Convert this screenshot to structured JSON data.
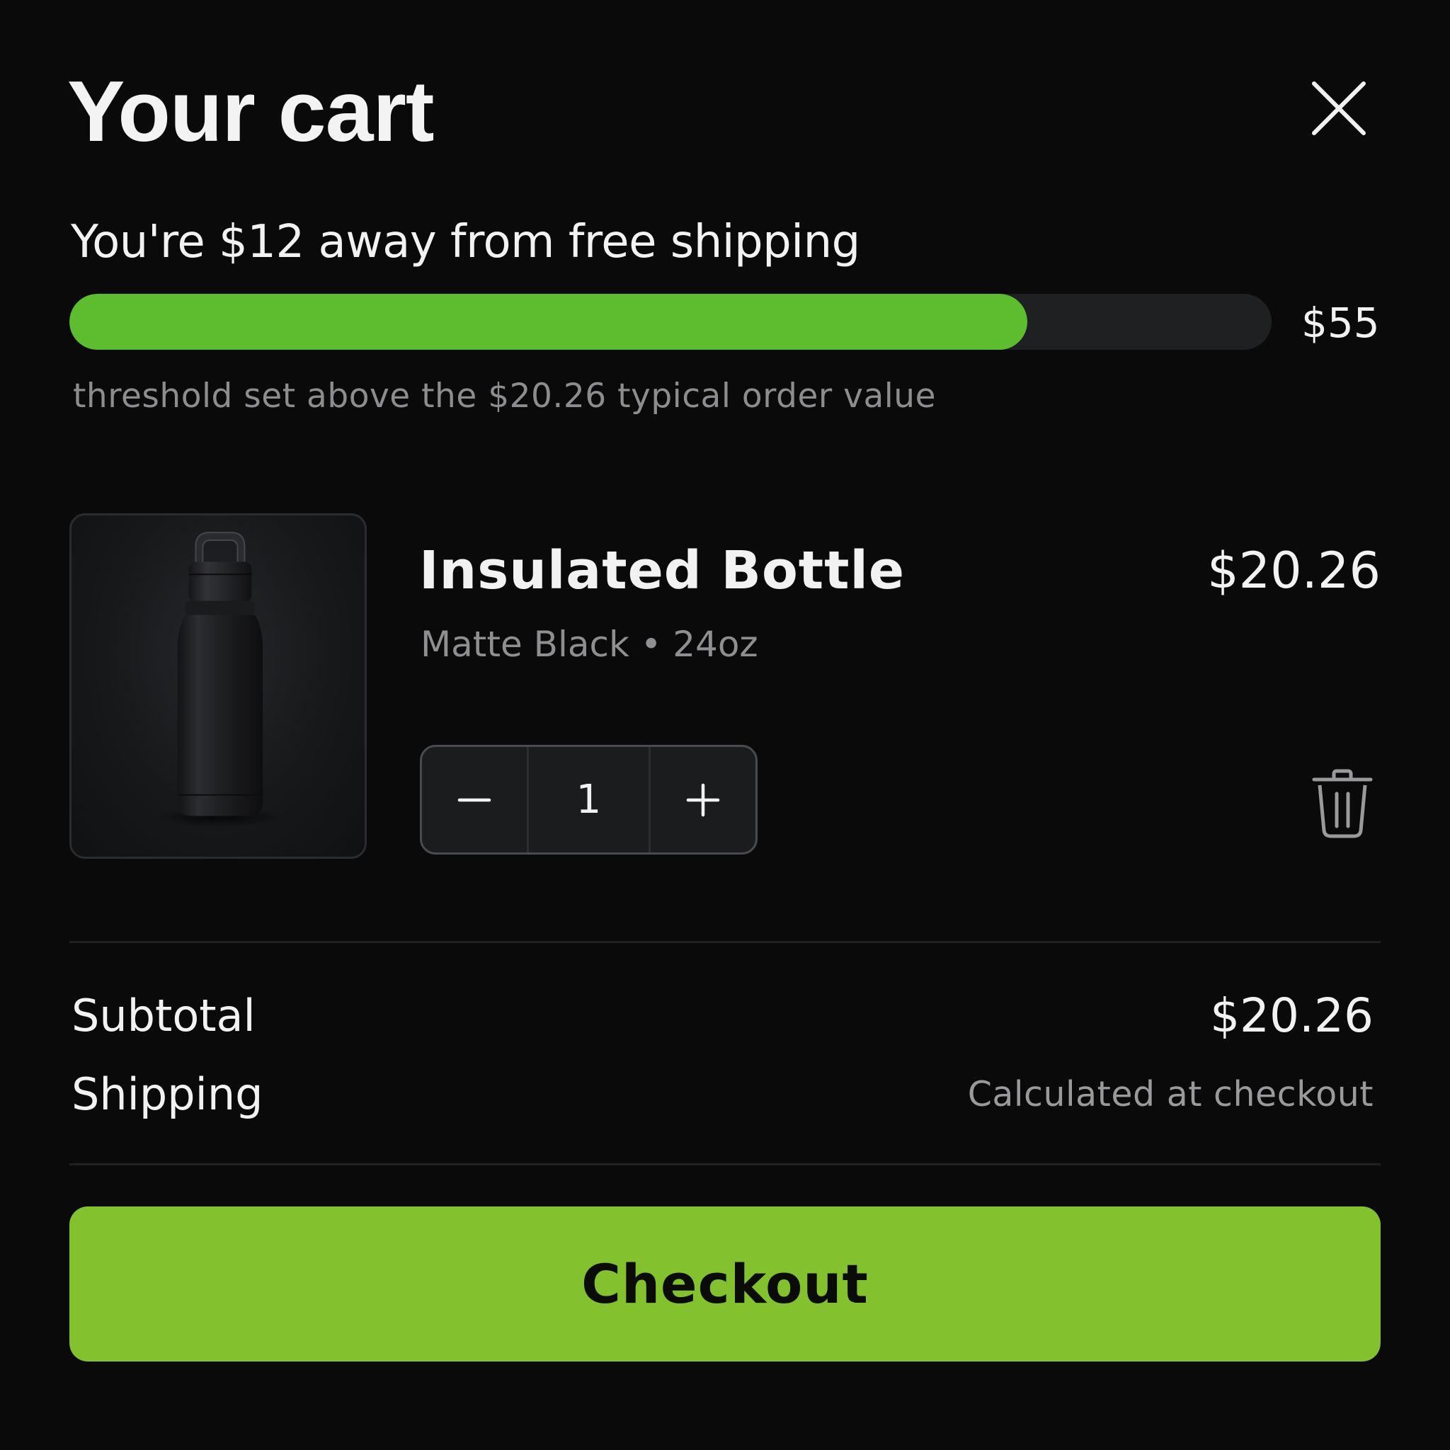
{
  "header": {
    "title": "Your cart",
    "close_icon": "close-icon"
  },
  "shipping": {
    "message": "You're $12 away from free shipping",
    "goal_label": "$55",
    "progress_fraction": 0.797,
    "note": "threshold set above the $20.26 typical order value",
    "bar_color": "#5dbd2f"
  },
  "cart_item": {
    "name": "Insulated Bottle",
    "variant": "Matte Black • 24oz",
    "price": "$20.26",
    "quantity": "1",
    "image_icon": "bottle-image",
    "remove_icon": "trash-icon",
    "decrement_icon": "minus-icon",
    "increment_icon": "plus-icon"
  },
  "summary": {
    "subtotal_label": "Subtotal",
    "subtotal_value": "$20.26",
    "shipping_label": "Shipping",
    "shipping_value": "Calculated at checkout"
  },
  "checkout": {
    "label": "Checkout",
    "color": "#84c12f"
  }
}
